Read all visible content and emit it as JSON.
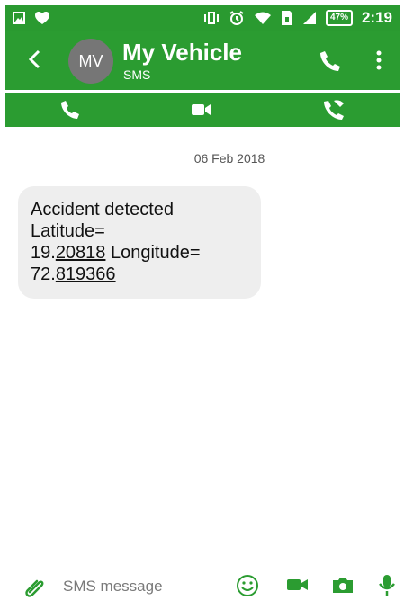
{
  "status_bar": {
    "time": "2:19",
    "battery": "47%",
    "icons": [
      "image-icon",
      "heart-icon",
      "vibrate-icon",
      "alarm-icon",
      "wifi-icon",
      "sim-icon",
      "signal-icon",
      "battery-icon"
    ]
  },
  "header": {
    "avatar_initials": "MV",
    "title": "My Vehicle",
    "subtitle": "SMS",
    "icons": [
      "back-icon",
      "phone-icon",
      "more-icon"
    ]
  },
  "action_bar": {
    "icons": [
      "phone-icon",
      "video-icon",
      "wifi-call-icon"
    ]
  },
  "conversation": {
    "date": "06 Feb 2018",
    "message": {
      "line1": "Accident detected",
      "line2": "Latitude=",
      "line3_prefix": "19.",
      "line3_link": "20818",
      "line3_suffix": " Longitude=",
      "line4_prefix": "72.",
      "line4_link": "819366"
    }
  },
  "compose": {
    "placeholder": "SMS message",
    "icons": [
      "attach-icon",
      "emoji-icon",
      "video-icon",
      "camera-icon",
      "mic-icon"
    ]
  },
  "colors": {
    "primary": "#2b9c31",
    "bubble": "#eeeeee",
    "text": "#111111"
  }
}
